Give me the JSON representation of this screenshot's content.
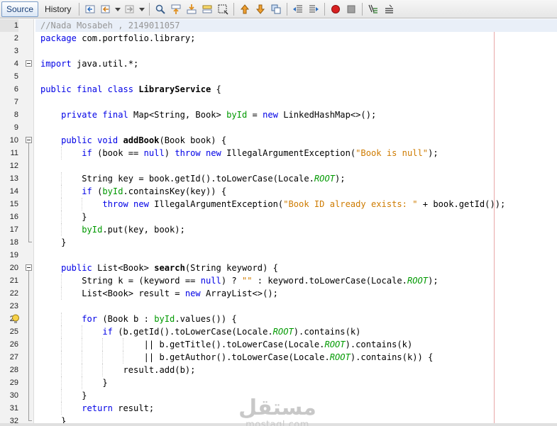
{
  "toolbar": {
    "tabs": [
      {
        "label": "Source",
        "active": true
      },
      {
        "label": "History",
        "active": false
      }
    ],
    "buttons": [
      "last-edit-icon",
      "back-icon",
      "dropdown-icon",
      "forward-icon",
      "dropdown-icon",
      "find-selection-icon",
      "find-previous-icon",
      "find-next-icon",
      "toggle-highlight-icon",
      "rectangular-selection-icon",
      "previous-bookmark-icon",
      "next-bookmark-icon",
      "toggle-bookmark-icon",
      "shift-left-icon",
      "shift-right-icon",
      "start-macro-icon",
      "stop-macro-icon",
      "comment-icon",
      "uncomment-icon"
    ]
  },
  "editor": {
    "current_line": 1,
    "colors": {
      "keyword": "#0000e6",
      "comment": "#969696",
      "string": "#ce7b00",
      "field": "#009900",
      "right_margin": "#e8a7a7"
    },
    "lines": [
      {
        "n": "1",
        "fold": "",
        "tokens": [
          [
            "cmt",
            "//Nada Mosabeh , 2149011057"
          ]
        ]
      },
      {
        "n": "2",
        "fold": "",
        "tokens": [
          [
            "kw",
            "package"
          ],
          [
            "",
            " com.portfolio.library;"
          ]
        ]
      },
      {
        "n": "3",
        "fold": "",
        "tokens": []
      },
      {
        "n": "4",
        "fold": "box",
        "tokens": [
          [
            "kw",
            "import"
          ],
          [
            "",
            " java.util.*;"
          ]
        ]
      },
      {
        "n": "5",
        "fold": "",
        "tokens": []
      },
      {
        "n": "6",
        "fold": "",
        "tokens": [
          [
            "kw",
            "public final class"
          ],
          [
            "",
            " "
          ],
          [
            "decl",
            "LibraryService"
          ],
          [
            "",
            " {"
          ]
        ]
      },
      {
        "n": "7",
        "fold": "",
        "tokens": []
      },
      {
        "n": "8",
        "fold": "",
        "tokens": [
          [
            "",
            "    "
          ],
          [
            "kw",
            "private final"
          ],
          [
            "",
            " Map<String, Book> "
          ],
          [
            "fld",
            "byId"
          ],
          [
            "",
            " = "
          ],
          [
            "kw",
            "new"
          ],
          [
            "",
            " LinkedHashMap<>();"
          ]
        ]
      },
      {
        "n": "9",
        "fold": "",
        "tokens": []
      },
      {
        "n": "10",
        "fold": "box",
        "tokens": [
          [
            "",
            "    "
          ],
          [
            "kw",
            "public void"
          ],
          [
            "",
            " "
          ],
          [
            "decl",
            "addBook"
          ],
          [
            "",
            "(Book book) {"
          ]
        ]
      },
      {
        "n": "11",
        "fold": "line",
        "tokens": [
          [
            "",
            "        "
          ],
          [
            "kw",
            "if"
          ],
          [
            "",
            " (book == "
          ],
          [
            "kw",
            "null"
          ],
          [
            "",
            ") "
          ],
          [
            "kw",
            "throw new"
          ],
          [
            "",
            " IllegalArgumentException("
          ],
          [
            "str",
            "\"Book is null\""
          ],
          [
            "",
            ");"
          ]
        ]
      },
      {
        "n": "12",
        "fold": "line",
        "tokens": []
      },
      {
        "n": "13",
        "fold": "line",
        "tokens": [
          [
            "",
            "        String key = book.getId().toLowerCase(Locale."
          ],
          [
            "ital",
            "ROOT"
          ],
          [
            "",
            ");"
          ]
        ]
      },
      {
        "n": "14",
        "fold": "line",
        "tokens": [
          [
            "",
            "        "
          ],
          [
            "kw",
            "if"
          ],
          [
            "",
            " ("
          ],
          [
            "fld",
            "byId"
          ],
          [
            "",
            ".containsKey(key)) {"
          ]
        ]
      },
      {
        "n": "15",
        "fold": "line",
        "tokens": [
          [
            "",
            "            "
          ],
          [
            "kw",
            "throw new"
          ],
          [
            "",
            " IllegalArgumentException("
          ],
          [
            "str",
            "\"Book ID already exists: \""
          ],
          [
            "",
            " + book.getId());"
          ]
        ]
      },
      {
        "n": "16",
        "fold": "line",
        "tokens": [
          [
            "",
            "        }"
          ]
        ]
      },
      {
        "n": "17",
        "fold": "line",
        "tokens": [
          [
            "",
            "        "
          ],
          [
            "fld",
            "byId"
          ],
          [
            "",
            ".put(key, book);"
          ]
        ]
      },
      {
        "n": "18",
        "fold": "end",
        "tokens": [
          [
            "",
            "    }"
          ]
        ]
      },
      {
        "n": "19",
        "fold": "",
        "tokens": []
      },
      {
        "n": "20",
        "fold": "box",
        "tokens": [
          [
            "",
            "    "
          ],
          [
            "kw",
            "public"
          ],
          [
            "",
            " List<Book> "
          ],
          [
            "decl",
            "search"
          ],
          [
            "",
            "(String keyword) {"
          ]
        ]
      },
      {
        "n": "21",
        "fold": "line",
        "tokens": [
          [
            "",
            "        String k = (keyword == "
          ],
          [
            "kw",
            "null"
          ],
          [
            "",
            ") ? "
          ],
          [
            "str",
            "\"\""
          ],
          [
            "",
            " : keyword.toLowerCase(Locale."
          ],
          [
            "ital",
            "ROOT"
          ],
          [
            "",
            ");"
          ]
        ]
      },
      {
        "n": "22",
        "fold": "line",
        "tokens": [
          [
            "",
            "        List<Book> result = "
          ],
          [
            "kw",
            "new"
          ],
          [
            "",
            " ArrayList<>();"
          ]
        ]
      },
      {
        "n": "23",
        "fold": "line",
        "tokens": []
      },
      {
        "n": "24",
        "fold": "line",
        "hint": true,
        "tokens": [
          [
            "",
            "        "
          ],
          [
            "kw",
            "for"
          ],
          [
            "",
            " (Book b : "
          ],
          [
            "fld",
            "byId"
          ],
          [
            "",
            ".values()) {"
          ]
        ]
      },
      {
        "n": "25",
        "fold": "line",
        "tokens": [
          [
            "",
            "            "
          ],
          [
            "kw",
            "if"
          ],
          [
            "",
            " (b.getId().toLowerCase(Locale."
          ],
          [
            "ital",
            "ROOT"
          ],
          [
            "",
            ").contains(k)"
          ]
        ]
      },
      {
        "n": "26",
        "fold": "line",
        "tokens": [
          [
            "",
            "                    || b.getTitle().toLowerCase(Locale."
          ],
          [
            "ital",
            "ROOT"
          ],
          [
            "",
            ").contains(k)"
          ]
        ]
      },
      {
        "n": "27",
        "fold": "line",
        "tokens": [
          [
            "",
            "                    || b.getAuthor().toLowerCase(Locale."
          ],
          [
            "ital",
            "ROOT"
          ],
          [
            "",
            ").contains(k)) {"
          ]
        ]
      },
      {
        "n": "28",
        "fold": "line",
        "tokens": [
          [
            "",
            "                result.add(b);"
          ]
        ]
      },
      {
        "n": "29",
        "fold": "line",
        "tokens": [
          [
            "",
            "            }"
          ]
        ]
      },
      {
        "n": "30",
        "fold": "line",
        "tokens": [
          [
            "",
            "        }"
          ]
        ]
      },
      {
        "n": "31",
        "fold": "line",
        "tokens": [
          [
            "",
            "        "
          ],
          [
            "kw",
            "return"
          ],
          [
            "",
            " result;"
          ]
        ]
      },
      {
        "n": "32",
        "fold": "end",
        "tokens": [
          [
            "",
            "    }"
          ]
        ]
      }
    ]
  },
  "watermark": {
    "logo": "مستقل",
    "text": "mostaql.com"
  }
}
